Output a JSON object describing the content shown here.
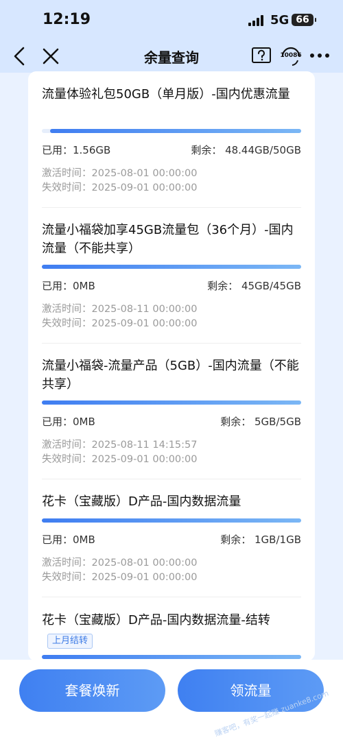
{
  "status_bar": {
    "time": "12:19",
    "network": "5G",
    "battery": "66"
  },
  "nav": {
    "title": "余量查询",
    "service_label": "10086"
  },
  "items": [
    {
      "title": "流量体验礼包50GB（单月版）-国内优惠流量",
      "used_label": "已用：1.56GB",
      "remain_label": "剩余：  48.44GB/50GB",
      "remaining_fraction": 0.969,
      "activate": "激活时间：2025-08-01 00:00:00",
      "expire": "失效时间：2025-09-01 00:00:00"
    },
    {
      "title": "流量小福袋加享45GB流量包（36个月）-国内流量（不能共享）",
      "used_label": "已用：0MB",
      "remain_label": "剩余：  45GB/45GB",
      "remaining_fraction": 1.0,
      "activate": "激活时间：2025-08-11 00:00:00",
      "expire": "失效时间：2025-09-01 00:00:00"
    },
    {
      "title": "流量小福袋-流量产品（5GB）-国内流量（不能共享）",
      "used_label": "已用：0MB",
      "remain_label": "剩余：  5GB/5GB",
      "remaining_fraction": 1.0,
      "activate": "激活时间：2025-08-11 14:15:57",
      "expire": "失效时间：2025-09-01 00:00:00"
    },
    {
      "title": "花卡（宝藏版）D产品-国内数据流量",
      "used_label": "已用：0MB",
      "remain_label": "剩余：  1GB/1GB",
      "remaining_fraction": 1.0,
      "activate": "激活时间：2025-08-01 00:00:00",
      "expire": "失效时间：2025-09-01 00:00:00"
    },
    {
      "title": "花卡（宝藏版）D产品-国内数据流量-结转",
      "tag": "上月结转",
      "remaining_fraction": 1.0
    }
  ],
  "actions": {
    "renew_label": "套餐焕新",
    "claim_label": "领流量"
  },
  "watermark": "赚客吧，有奖一起赚 zuanke8.com",
  "colors": {
    "accent": "#3f80f1",
    "header_bg": "#d7e7ff",
    "muted_text": "#9a9a9a"
  }
}
